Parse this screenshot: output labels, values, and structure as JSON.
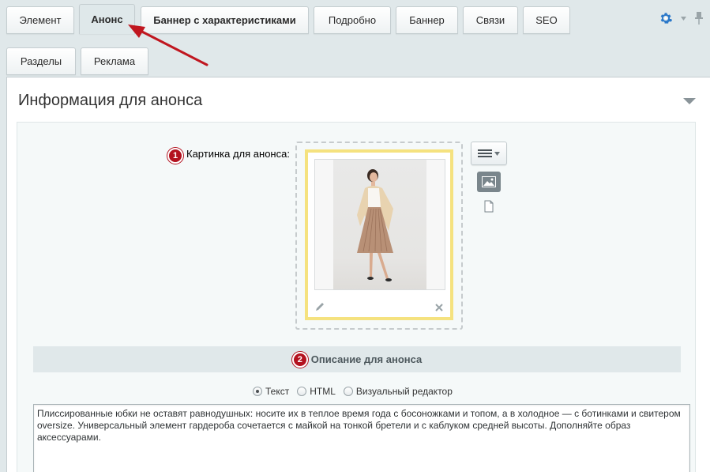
{
  "tabs_row1": [
    {
      "label": "Элемент",
      "active": false
    },
    {
      "label": "Анонс",
      "active": true
    },
    {
      "label": "Баннер с характеристиками",
      "active": false
    },
    {
      "label": "Подробно",
      "active": false
    },
    {
      "label": "Баннер",
      "active": false
    },
    {
      "label": "Связи",
      "active": false
    },
    {
      "label": "SEO",
      "active": false
    }
  ],
  "tabs_row2": [
    {
      "label": "Разделы"
    },
    {
      "label": "Реклама"
    }
  ],
  "section": {
    "title": "Информация для анонса"
  },
  "preview_picture": {
    "badge": "1",
    "label": "Картинка для анонса:"
  },
  "description": {
    "badge": "2",
    "header": "Описание для анонса",
    "mode_options": [
      "Текст",
      "HTML",
      "Визуальный редактор"
    ],
    "selected_mode": "Текст",
    "text": "Плиссированные юбки не оставят равнодушных: носите их в теплое время года с босоножками и топом, а в холодное — с ботинками и свитером oversize. Универсальный элемент гардероба сочетается с майкой на тонкой бретели и с каблуком средней высоты. Дополняйте образ аксессуарами."
  },
  "colors": {
    "accent_red": "#b3121f",
    "gear_blue": "#2b78c9",
    "frame_yellow": "#f5e27f"
  }
}
